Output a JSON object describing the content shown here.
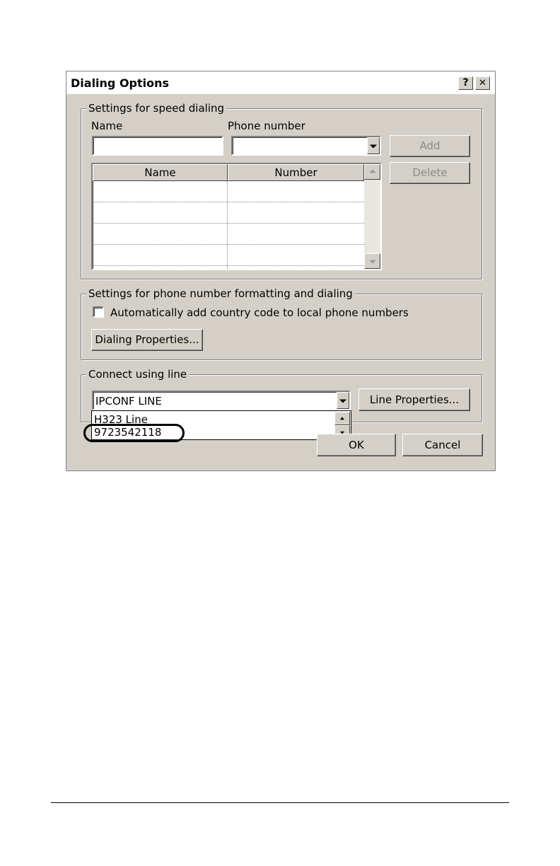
{
  "dialog": {
    "title": "Dialing Options",
    "help_label": "?",
    "close_label": "✕"
  },
  "speed_dialing": {
    "group_label": "Settings for speed dialing",
    "name_label": "Name",
    "phone_label": "Phone number",
    "name_value": "",
    "phone_value": "",
    "add_button": "Add",
    "delete_button": "Delete",
    "table": {
      "columns": [
        "Name",
        "Number"
      ],
      "rows": [
        [
          "",
          ""
        ],
        [
          "",
          ""
        ],
        [
          "",
          ""
        ],
        [
          "",
          ""
        ]
      ]
    }
  },
  "formatting": {
    "group_label": "Settings for phone number formatting and dialing",
    "checkbox_label": "Automatically add country code to local phone numbers",
    "checkbox_checked": false,
    "dialing_properties_button": "Dialing Properties..."
  },
  "connect": {
    "group_label": "Connect using line",
    "selected_line": "IPCONF LINE",
    "line_properties_button": "Line Properties...",
    "options": [
      "H323 Line",
      "9723542118"
    ]
  },
  "footer": {
    "ok_button": "OK",
    "cancel_button": "Cancel"
  }
}
